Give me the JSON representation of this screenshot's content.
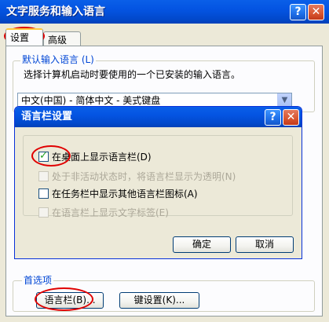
{
  "main_window": {
    "title": "文字服务和输入语言",
    "help_button": "?",
    "close_button": "✕",
    "tabs": [
      {
        "label": "设置",
        "selected": true
      },
      {
        "label": "高级",
        "selected": false
      }
    ]
  },
  "default_language": {
    "group_label": "默认输入语言 (L)",
    "description": "选择计算机启动时要使用的一个已安装的输入语言。",
    "selected_value": "中文(中国) - 简体中文 - 美式键盘"
  },
  "preferences": {
    "group_label": "首选项",
    "language_bar_button": "语言栏(B)...",
    "key_settings_button": "键设置(K)..."
  },
  "language_bar_dialog": {
    "title": "语言栏设置",
    "help_button": "?",
    "close_button": "✕",
    "options": [
      {
        "label": "在桌面上显示语言栏(D)",
        "checked": true,
        "enabled": true
      },
      {
        "label": "处于非活动状态时，将语言栏显示为透明(N)",
        "checked": false,
        "enabled": false
      },
      {
        "label": "在任务栏中显示其他语言栏图标(A)",
        "checked": false,
        "enabled": true
      },
      {
        "label": "在语言栏上显示文字标签(E)",
        "checked": false,
        "enabled": false
      }
    ],
    "ok_button": "确定",
    "cancel_button": "取消"
  },
  "colors": {
    "titlebar": "#0454E2",
    "dialog_face": "#ECE9D8",
    "annotation_red": "#E00000",
    "group_label": "#0046D5"
  }
}
